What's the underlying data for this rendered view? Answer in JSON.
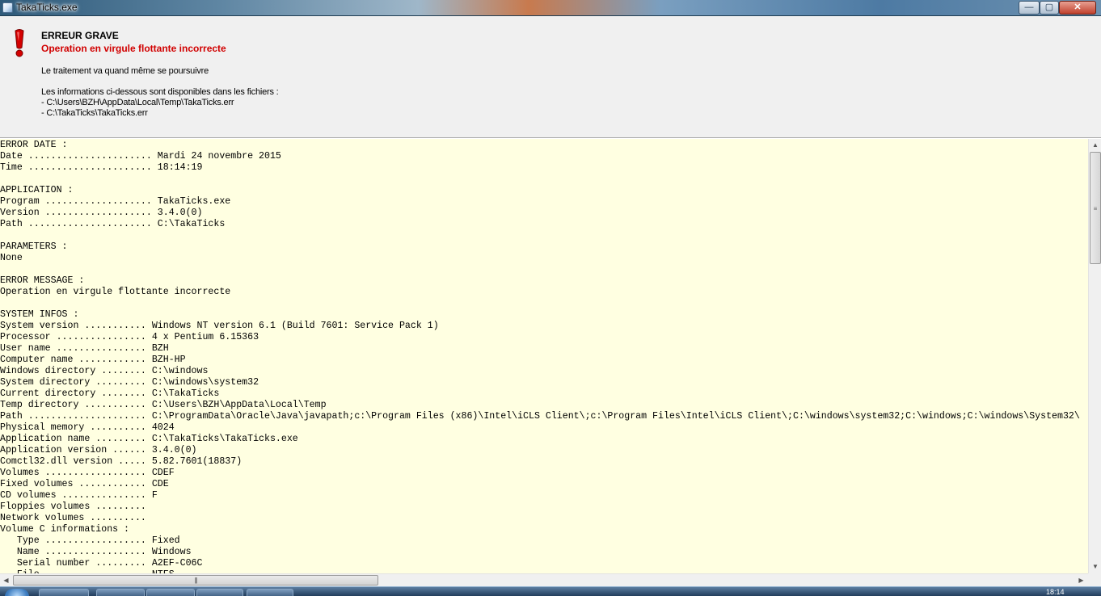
{
  "window": {
    "title": "TakaTicks.exe",
    "buttons": {
      "minimize": "—",
      "maximize": "▢",
      "close": "✕"
    }
  },
  "header": {
    "title": "ERREUR GRAVE",
    "subtitle": "Operation en virgule flottante incorrecte",
    "continue_text": "Le traitement va quand même se poursuivre",
    "info_intro": "Les informations ci-dessous sont disponibles dans les fichiers :",
    "file1": "- C:\\Users\\BZH\\AppData\\Local\\Temp\\TakaTicks.err",
    "file2": "- C:\\TakaTicks\\TakaTicks.err",
    "icon": "exclamation-icon",
    "accent_color": "#d10000"
  },
  "log": {
    "background": "#ffffe1",
    "lines": [
      "ERROR DATE :",
      "Date ...................... Mardi 24 novembre 2015",
      "Time ...................... 18:14:19",
      "",
      "APPLICATION :",
      "Program ................... TakaTicks.exe",
      "Version ................... 3.4.0(0)",
      "Path ...................... C:\\TakaTicks",
      "",
      "PARAMETERS :",
      "None",
      "",
      "ERROR MESSAGE :",
      "Operation en virgule flottante incorrecte",
      "",
      "SYSTEM INFOS :",
      "System version ........... Windows NT version 6.1 (Build 7601: Service Pack 1)",
      "Processor ................ 4 x Pentium 6.15363",
      "User name ................ BZH",
      "Computer name ............ BZH-HP",
      "Windows directory ........ C:\\windows",
      "System directory ......... C:\\windows\\system32",
      "Current directory ........ C:\\TakaTicks",
      "Temp directory ........... C:\\Users\\BZH\\AppData\\Local\\Temp",
      "Path ..................... C:\\ProgramData\\Oracle\\Java\\javapath;c:\\Program Files (x86)\\Intel\\iCLS Client\\;c:\\Program Files\\Intel\\iCLS Client\\;C:\\windows\\system32;C:\\windows;C:\\windows\\System32\\",
      "Physical memory .......... 4024",
      "Application name ......... C:\\TakaTicks\\TakaTicks.exe",
      "Application version ...... 3.4.0(0)",
      "Comctl32.dll version ..... 5.82.7601(18837)",
      "Volumes .................. CDEF",
      "Fixed volumes ............ CDE",
      "CD volumes ............... F",
      "Floppies volumes .........",
      "Network volumes ..........",
      "Volume C informations :",
      "   Type .................. Fixed",
      "   Name .................. Windows",
      "   Serial number ......... A2EF-C06C",
      "   File .................. NTFS"
    ]
  },
  "scrollbars": {
    "vertical_thumb_grip": "≡",
    "horizontal_thumb_grip": "|||",
    "up_arrow": "▲",
    "down_arrow": "▼",
    "left_arrow": "◀",
    "right_arrow": "▶"
  },
  "taskbar": {
    "clock": "18:14"
  }
}
